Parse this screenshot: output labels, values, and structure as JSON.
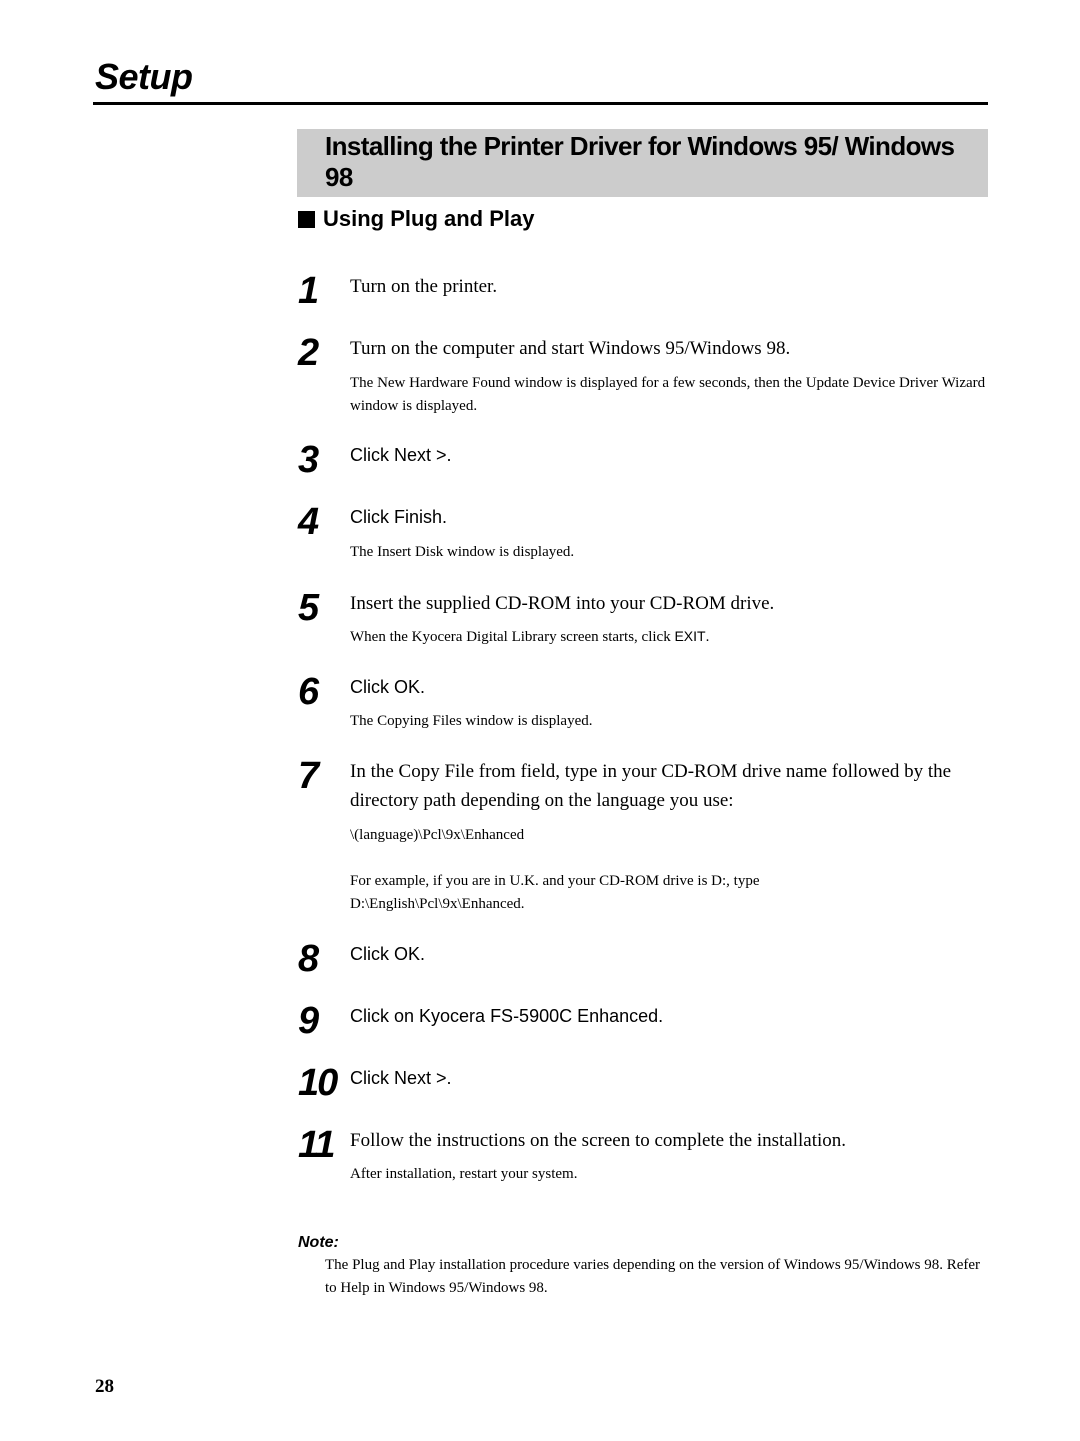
{
  "running_head": "Setup",
  "section_title": "Installing the Printer Driver for Windows 95/ Windows 98",
  "subsection_title": "Using Plug and Play",
  "steps": [
    {
      "number": "1",
      "text": "Turn on the printer."
    },
    {
      "number": "2",
      "text": "Turn on the computer and start Windows 95/Windows 98.",
      "detail": "The New Hardware Found window is displayed for a few seconds, then the Update Device Driver Wizard window is displayed."
    },
    {
      "number": "3",
      "text": "Click Next >."
    },
    {
      "number": "4",
      "text": "Click Finish.",
      "detail": "The Insert Disk window is displayed."
    },
    {
      "number": "5",
      "text": "Insert the supplied CD-ROM into your CD-ROM drive.",
      "detail_prefix": "When the Kyocera Digital Library screen starts, click ",
      "detail_ui": "EXIT",
      "detail_suffix": "."
    },
    {
      "number": "6",
      "text": "Click OK.",
      "detail": "The Copying Files window is displayed."
    },
    {
      "number": "7",
      "text": "In the Copy File from field, type in your CD-ROM drive name followed by the directory path depending on the language you use:",
      "path": "\\(language)\\Pcl\\9x\\Enhanced",
      "example": "For example, if you are in U.K. and your CD-ROM drive is D:, type D:\\English\\Pcl\\9x\\Enhanced."
    },
    {
      "number": "8",
      "text": "Click OK."
    },
    {
      "number": "9",
      "text_prefix": "Click on ",
      "text_ui": "Kyocera FS-5900C Enhanced."
    },
    {
      "number": "10",
      "text": "Click Next >."
    },
    {
      "number": "11",
      "text": "Follow the instructions on the screen to complete the installation.",
      "detail": "After installation, restart your system."
    }
  ],
  "note": {
    "label": "Note:",
    "text": "The Plug and Play installation procedure varies depending on the version of Windows 95/Windows 98. Refer to Help in Windows 95/Windows 98."
  },
  "page_number": "28",
  "colors": {
    "title_box": "#cccccc",
    "text": "#000000"
  }
}
